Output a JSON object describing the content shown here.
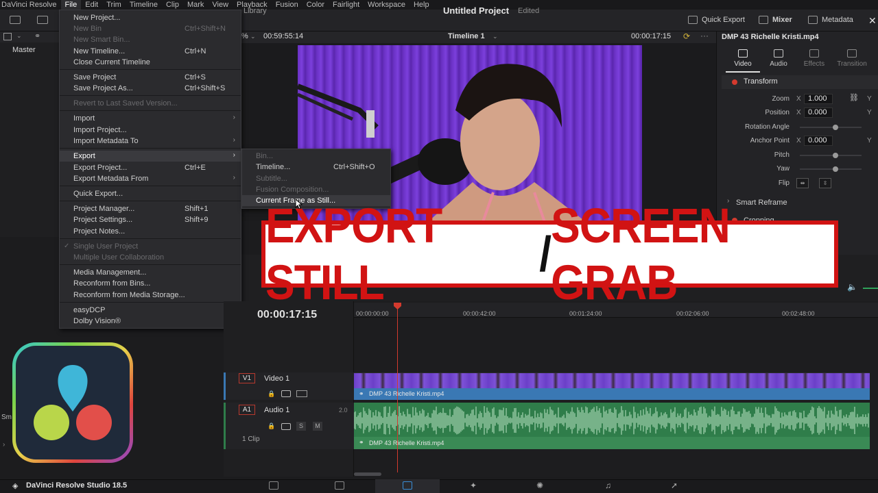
{
  "menubar": {
    "app_name": "DaVinci Resolve",
    "items": [
      "File",
      "Edit",
      "Trim",
      "Timeline",
      "Clip",
      "Mark",
      "View",
      "Playback",
      "Fusion",
      "Color",
      "Fairlight",
      "Workspace",
      "Help"
    ],
    "active": "File"
  },
  "titlebar": {
    "project_title": "Untitled Project",
    "status": "Edited",
    "library_label": "Library",
    "quick_export": "Quick Export",
    "mixer": "Mixer",
    "metadata": "Metadata"
  },
  "viewer": {
    "zoom_fragment": "%",
    "source_timecode": "00:59:55:14",
    "timeline_name": "Timeline 1",
    "record_timecode": "00:00:17:15"
  },
  "media_pool": {
    "master_label": "Master"
  },
  "file_menu": {
    "items": [
      {
        "label": "New Project...",
        "shortcut": "",
        "disabled": false
      },
      {
        "label": "New Bin",
        "shortcut": "Ctrl+Shift+N",
        "disabled": true
      },
      {
        "label": "New Smart Bin...",
        "shortcut": "",
        "disabled": true
      },
      {
        "label": "New Timeline...",
        "shortcut": "Ctrl+N",
        "disabled": false
      },
      {
        "label": "Close Current Timeline",
        "shortcut": "",
        "disabled": false
      },
      {
        "label": "Save Project",
        "shortcut": "Ctrl+S",
        "disabled": false
      },
      {
        "label": "Save Project As...",
        "shortcut": "Ctrl+Shift+S",
        "disabled": false
      },
      {
        "label": "Revert to Last Saved Version...",
        "shortcut": "",
        "disabled": true
      },
      {
        "label": "Import",
        "shortcut": "",
        "disabled": false
      },
      {
        "label": "Import Project...",
        "shortcut": "",
        "disabled": false
      },
      {
        "label": "Import Metadata To",
        "shortcut": "",
        "disabled": false
      },
      {
        "label": "Export",
        "shortcut": "",
        "disabled": false
      },
      {
        "label": "Export Project...",
        "shortcut": "Ctrl+E",
        "disabled": false
      },
      {
        "label": "Export Metadata From",
        "shortcut": "",
        "disabled": false
      },
      {
        "label": "Quick Export...",
        "shortcut": "",
        "disabled": false
      },
      {
        "label": "Project Manager...",
        "shortcut": "Shift+1",
        "disabled": false
      },
      {
        "label": "Project Settings...",
        "shortcut": "Shift+9",
        "disabled": false
      },
      {
        "label": "Project Notes...",
        "shortcut": "",
        "disabled": false
      },
      {
        "label": "Single User Project",
        "shortcut": "",
        "disabled": true
      },
      {
        "label": "Multiple User Collaboration",
        "shortcut": "",
        "disabled": true
      },
      {
        "label": "Media Management...",
        "shortcut": "",
        "disabled": false
      },
      {
        "label": "Reconform from Bins...",
        "shortcut": "",
        "disabled": false
      },
      {
        "label": "Reconform from Media Storage...",
        "shortcut": "",
        "disabled": false
      },
      {
        "label": "easyDCP",
        "shortcut": "",
        "disabled": false
      },
      {
        "label": "Dolby Vision®",
        "shortcut": "",
        "disabled": false
      }
    ]
  },
  "export_submenu": {
    "items": [
      {
        "label": "Bin...",
        "shortcut": "",
        "disabled": true
      },
      {
        "label": "Timeline...",
        "shortcut": "Ctrl+Shift+O",
        "disabled": false
      },
      {
        "label": "Subtitle...",
        "shortcut": "",
        "disabled": true
      },
      {
        "label": "Fusion Composition...",
        "shortcut": "",
        "disabled": true
      },
      {
        "label": "Current Frame as Still...",
        "shortcut": "",
        "disabled": false
      }
    ]
  },
  "inspector": {
    "clip_name": "DMP 43 Richelle Kristi.mp4",
    "tabs": [
      "Video",
      "Audio",
      "Effects",
      "Transition"
    ],
    "active_tab": "Video",
    "section": "Transform",
    "properties": {
      "zoom_label": "Zoom",
      "zoom_x": "1.000",
      "position_label": "Position",
      "position_x": "0.000",
      "rotation_label": "Rotation Angle",
      "anchor_label": "Anchor Point",
      "anchor_x": "0.000",
      "pitch_label": "Pitch",
      "yaw_label": "Yaw",
      "flip_label": "Flip",
      "axis_x": "X",
      "axis_y": "Y"
    },
    "smart_reframe": "Smart Reframe",
    "cropping": "Cropping"
  },
  "banner": {
    "text_red_1": "EXPORT STILL",
    "slash": "/",
    "text_red_2": "SCREEN GRAB"
  },
  "timeline": {
    "timecode": "00:00:17:15",
    "ruler_ticks": [
      "00:00:00:00",
      "00:00:42:00",
      "00:01:24:00",
      "00:02:06:00",
      "00:02:48:00"
    ],
    "video_track": {
      "badge": "V1",
      "name": "Video 1",
      "clip": "DMP 43 Richelle Kristi.mp4"
    },
    "audio_track": {
      "badge": "A1",
      "name": "Audio 1",
      "channels": "2.0",
      "clip_count": "1 Clip",
      "solo": "S",
      "mute": "M",
      "clip": "DMP 43 Richelle Kristi.mp4"
    }
  },
  "bottombar": {
    "version": "DaVinci Resolve Studio 18.5"
  },
  "left_fragment": "Sm",
  "colors": {
    "accent_red": "#d11313",
    "video_clip": "#3a78b4",
    "audio_clip": "#2f7d4a",
    "playhead": "#d33a2e"
  }
}
